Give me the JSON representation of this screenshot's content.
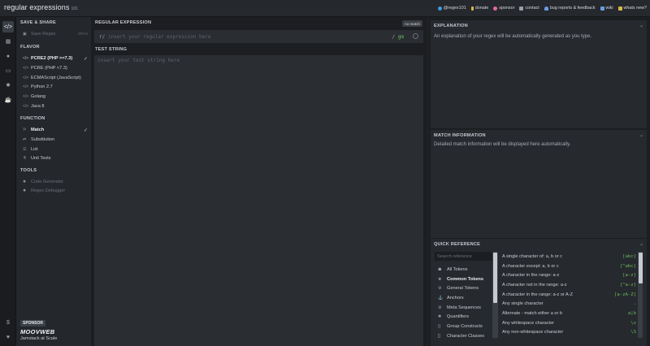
{
  "app": {
    "logo": "regular expressions",
    "logo_sub": "101"
  },
  "toplinks": [
    {
      "icon": "twitter-icon",
      "label": "@regex101"
    },
    {
      "icon": "dollar-icon",
      "label": "donate"
    },
    {
      "icon": "heart-icon",
      "label": "sponsor"
    },
    {
      "icon": "mail-icon",
      "label": "contact"
    },
    {
      "icon": "bug-icon",
      "label": "bug reports & feedback"
    },
    {
      "icon": "book-icon",
      "label": "wiki"
    },
    {
      "icon": "news-icon",
      "label": "whats new?"
    }
  ],
  "sidebar": {
    "save_share_title": "SAVE & SHARE",
    "save_regex_label": "Save Regex",
    "save_regex_shortcut": "ctrl+s",
    "flavor_title": "FLAVOR",
    "flavors": [
      {
        "label": "PCRE2 (PHP >=7.3)",
        "selected": true
      },
      {
        "label": "PCRE (PHP <7.3)",
        "selected": false
      },
      {
        "label": "ECMAScript (JavaScript)",
        "selected": false
      },
      {
        "label": "Python 2.7",
        "selected": false
      },
      {
        "label": "Golang",
        "selected": false
      },
      {
        "label": "Java 8",
        "selected": false
      }
    ],
    "function_title": "FUNCTION",
    "functions": [
      {
        "label": "Match",
        "selected": true
      },
      {
        "label": "Substitution",
        "selected": false
      },
      {
        "label": "List",
        "selected": false
      },
      {
        "label": "Unit Tests",
        "selected": false
      }
    ],
    "tools_title": "TOOLS",
    "tools": [
      {
        "label": "Code Generator"
      },
      {
        "label": "Regex Debugger"
      }
    ],
    "sponsor_badge": "SPONSOR",
    "sponsor_logo": "MOOVWEB",
    "sponsor_text": "Jamstack at Scale"
  },
  "editor": {
    "regex_title": "REGULAR EXPRESSION",
    "no_match": "no match",
    "regex_delim_open": "r/",
    "regex_placeholder": "insert your regular expression here",
    "regex_delim_close": "/",
    "regex_flags": "gm",
    "test_title": "TEST STRING",
    "test_placeholder": "insert your test string here"
  },
  "explanation": {
    "title": "EXPLANATION",
    "body": "An explanation of your regex will be automatically generated as you type."
  },
  "match_info": {
    "title": "MATCH INFORMATION",
    "body": "Detailed match information will be displayed here automatically."
  },
  "quick_ref": {
    "title": "QUICK REFERENCE",
    "search_placeholder": "Search reference",
    "categories": [
      {
        "icon": "star-icon",
        "label": "All Tokens",
        "active": false
      },
      {
        "icon": "star-icon",
        "label": "Common Tokens",
        "active": true
      },
      {
        "icon": "gear-icon",
        "label": "General Tokens",
        "active": false
      },
      {
        "icon": "anchor-icon",
        "label": "Anchors",
        "active": false
      },
      {
        "icon": "gear-icon",
        "label": "Meta Sequences",
        "active": false
      },
      {
        "icon": "asterisk-icon",
        "label": "Quantifiers",
        "active": false
      },
      {
        "icon": "parens-icon",
        "label": "Group Constructs",
        "active": false
      },
      {
        "icon": "brackets-icon",
        "label": "Character Classes",
        "active": false
      }
    ],
    "items": [
      {
        "desc": "A single character of: a, b or c",
        "token": "[abc]"
      },
      {
        "desc": "A character except: a, b or c",
        "token": "[^abc]"
      },
      {
        "desc": "A character in the range: a-z",
        "token": "[a-z]"
      },
      {
        "desc": "A character not in the range: a-z",
        "token": "[^a-z]"
      },
      {
        "desc": "A character in the range: a-z or A-Z",
        "token": "[a-zA-Z]"
      },
      {
        "desc": "Any single character",
        "token": "."
      },
      {
        "desc": "Alternate - match either a or b",
        "token": "a|b"
      },
      {
        "desc": "Any whitespace character",
        "token": "\\s"
      },
      {
        "desc": "Any non-whitespace character",
        "token": "\\S"
      }
    ]
  },
  "colors": {
    "accent_green": "#6bbf59",
    "background": "#1f2125"
  }
}
